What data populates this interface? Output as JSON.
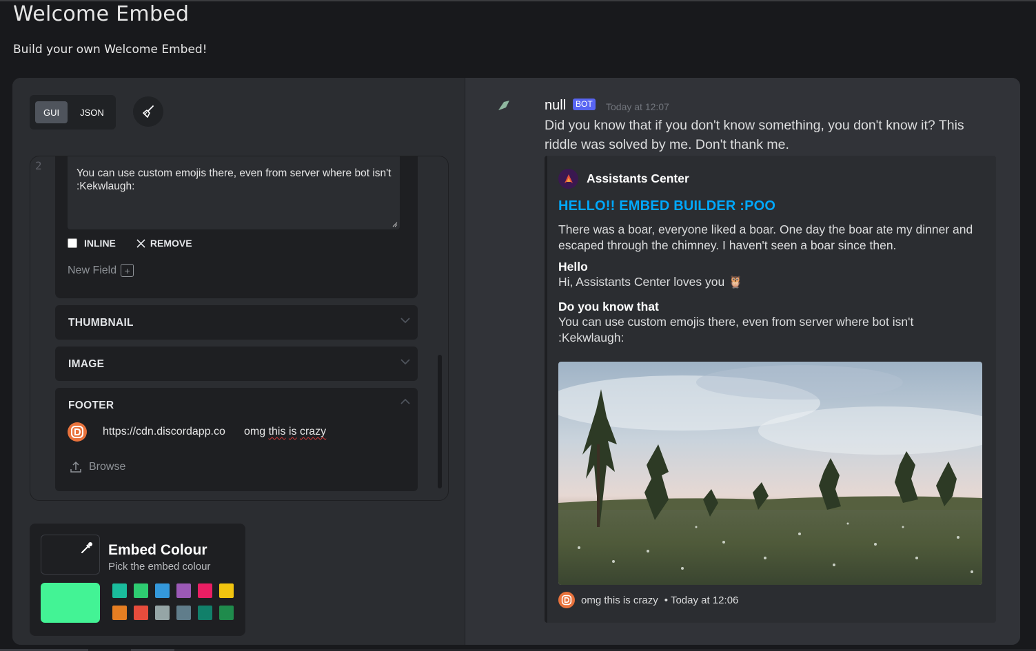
{
  "header": {
    "title": "Welcome Embed",
    "subtitle": "Build your own Welcome Embed!"
  },
  "editor": {
    "mode_gui": "GUI",
    "mode_json": "JSON",
    "line_number": "2",
    "field_value": "You can use custom emojis there, even from server where bot isn't :Kekwlaugh:",
    "inline_label": "INLINE",
    "remove_label": "REMOVE",
    "new_field_label": "New Field",
    "sections": {
      "thumbnail": "THUMBNAIL",
      "image": "IMAGE",
      "footer": "FOOTER"
    },
    "footer_icon_url": "https://cdn.discordapp.co",
    "footer_text_prefix": "omg ",
    "footer_text_this": "this",
    "footer_text_is": "is",
    "footer_text_crazy": "crazy",
    "browse_label": "Browse"
  },
  "colour_picker": {
    "title": "Embed Colour",
    "subtitle": "Pick the embed colour",
    "current": "#43f395",
    "swatches": [
      "#1abc9c",
      "#2ecc71",
      "#3498db",
      "#9b59b6",
      "#e91e63",
      "#f1c40f",
      "#e67e22",
      "#e74c3c",
      "#95a5a6",
      "#607d8b",
      "#11806a",
      "#1f8b4c"
    ]
  },
  "preview": {
    "username": "null",
    "bot_badge": "BOT",
    "timestamp": "Today at 12:07",
    "content": "Did you know that if you don't know something, you don't know it? This riddle was solved by me. Don't thank me.",
    "embed": {
      "author": "Assistants Center",
      "title": "HELLO!! EMBED BUILDER :POO",
      "description": "There was a boar, everyone liked a boar. One day the boar ate my dinner and escaped through the chimney. I haven't seen a boar since then.",
      "fields": [
        {
          "name": "Hello",
          "value": "Hi, Assistants Center loves you 🦉"
        },
        {
          "name": "Do you know that",
          "value": "You can use custom emojis there, even from server where bot isn't :Kekwlaugh:"
        }
      ],
      "footer_text": "omg this is crazy",
      "footer_separator": "•",
      "footer_timestamp": "Today at 12:06"
    }
  }
}
